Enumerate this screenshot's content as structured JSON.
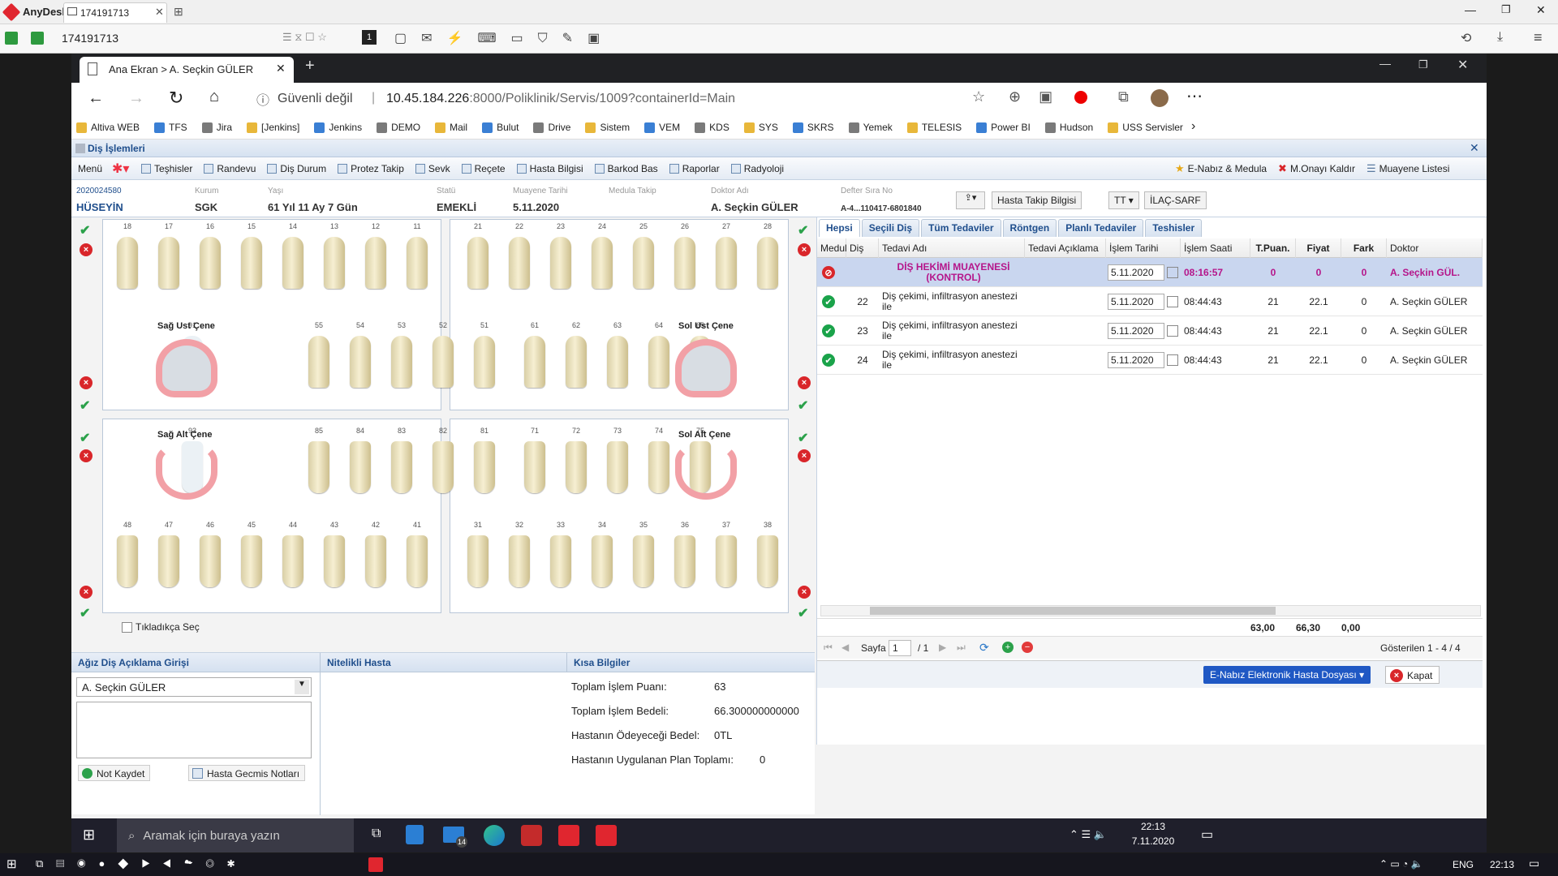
{
  "anydesk": {
    "app_name": "AnyDesk",
    "tab_title": "174191713",
    "address": "174191713",
    "toolbar_page": "1"
  },
  "browser": {
    "tab_title": "Ana Ekran > A. Seçkin GÜLER",
    "security": "Güvenli değil",
    "url_host": "10.45.184.226",
    "url_rest": ":8000/Poliklinik/Servis/1009?containerId=Main",
    "bookmarks": [
      "Altiva WEB",
      "TFS",
      "Jira",
      "[Jenkins]",
      "Jenkins",
      "DEMO",
      "Mail",
      "Bulut",
      "Drive",
      "Sistem",
      "VEM",
      "KDS",
      "SYS",
      "SKRS",
      "Yemek",
      "TELESIS",
      "Power BI",
      "Hudson",
      "USS Servisler"
    ]
  },
  "window": {
    "title": "Diş İşlemleri"
  },
  "toolbar": {
    "menu": "Menü",
    "items": [
      "Teşhisler",
      "Randevu",
      "Diş Durum",
      "Protez Takip",
      "Sevk",
      "Reçete",
      "Hasta Bilgisi",
      "Barkod Bas",
      "Raporlar",
      "Radyoloji"
    ],
    "right": [
      "E-Nabız & Medula",
      "M.Onayı Kaldır",
      "Muayene Listesi"
    ]
  },
  "patient": {
    "id": "2020024580",
    "name": "HÜSEYİN",
    "kurum_label": "Kurum",
    "kurum": "SGK",
    "yas_label": "Yaşı",
    "yas": "61 Yıl 11 Ay 7 Gün",
    "statu_label": "Statü",
    "statu": "EMEKLİ",
    "muayene_label": "Muayene Tarihi",
    "muayene": "5.11.2020",
    "medula_label": "Medula Takip",
    "medula": "",
    "doktor_label": "Doktor Adı",
    "doktor": "A. Seçkin GÜLER",
    "defter_label": "Defter Sıra No",
    "defter": "A-4...110417-6801840",
    "btn_takip": "Hasta Takip Bilgisi",
    "btn_tt": "TT",
    "btn_ilac": "İLAÇ-SARF"
  },
  "chart": {
    "upper_right_nums": [
      "18",
      "17",
      "16",
      "15",
      "14",
      "13",
      "12",
      "11"
    ],
    "upper_left_nums": [
      "21",
      "22",
      "23",
      "24",
      "25",
      "26",
      "27",
      "28"
    ],
    "primary_ur": [
      "91",
      "55",
      "54",
      "53",
      "52",
      "51"
    ],
    "primary_ul": [
      "61",
      "62",
      "63",
      "64",
      "65",
      "92"
    ],
    "primary_lr": [
      "93",
      "85",
      "84",
      "83",
      "82",
      "81"
    ],
    "primary_ll": [
      "71",
      "72",
      "73",
      "74",
      "75",
      "94"
    ],
    "lower_right_nums": [
      "48",
      "47",
      "46",
      "45",
      "44",
      "43",
      "42",
      "41"
    ],
    "lower_left_nums": [
      "31",
      "32",
      "33",
      "34",
      "35",
      "36",
      "37",
      "38"
    ],
    "label_sag_ust": "Sağ Ust Çene",
    "label_sol_ust": "Sol Ust Çene",
    "label_sag_alt": "Sağ Alt Çene",
    "label_sol_alt": "Sol Alt Çene",
    "tikladikca": "Tıkladıkça Seç"
  },
  "tabs": [
    "Hepsi",
    "Seçili Diş",
    "Tüm Tedaviler",
    "Röntgen",
    "Planlı Tedaviler",
    "Teshisler"
  ],
  "grid": {
    "headers": [
      "Medul",
      "Diş",
      "Tedavi Adı",
      "Tedavi Açıklama",
      "İşlem Tarihi",
      "İşlem Saati",
      "T.Puan.",
      "Fiyat",
      "Fark",
      "Doktor"
    ],
    "rows": [
      {
        "dis": "",
        "tedavi": "DİŞ HEKİMİ MUAYENESİ (KONTROL)",
        "tarih": "5.11.2020",
        "saat": "08:16:57",
        "puan": "0",
        "fiyat": "0",
        "fark": "0",
        "doktor": "A. Seçkin GÜL."
      },
      {
        "dis": "22",
        "tedavi": "Diş çekimi, infiltrasyon anestezi ile",
        "tarih": "5.11.2020",
        "saat": "08:44:43",
        "puan": "21",
        "fiyat": "22.1",
        "fark": "0",
        "doktor": "A. Seçkin GÜLER"
      },
      {
        "dis": "23",
        "tedavi": "Diş çekimi, infiltrasyon anestezi ile",
        "tarih": "5.11.2020",
        "saat": "08:44:43",
        "puan": "21",
        "fiyat": "22.1",
        "fark": "0",
        "doktor": "A. Seçkin GÜLER"
      },
      {
        "dis": "24",
        "tedavi": "Diş çekimi, infiltrasyon anestezi ile",
        "tarih": "5.11.2020",
        "saat": "08:44:43",
        "puan": "21",
        "fiyat": "22.1",
        "fark": "0",
        "doktor": "A. Seçkin GÜLER"
      }
    ],
    "total_puan": "63,00",
    "total_fiyat": "66,30",
    "total_fark": "0,00",
    "sayfa_label": "Sayfa",
    "page": "1",
    "of_pages": "/ 1",
    "showing": "Gösterilen 1 - 4 / 4"
  },
  "bottom": {
    "aciklama_title": "Ağız Diş Açıklama Girişi",
    "doktor_select": "A. Seçkin GÜLER",
    "not_kaydet": "Not Kaydet",
    "gecmis": "Hasta Gecmis Notları",
    "nitelikli_title": "Nitelikli Hasta",
    "kisa_title": "Kısa Bilgiler",
    "kisa": [
      {
        "label": "Toplam İşlem Puanı:",
        "value": "63"
      },
      {
        "label": "Toplam İşlem Bedeli:",
        "value": "66.300000000000"
      },
      {
        "label": "Hastanın Ödeyeceği Bedel:",
        "value": "0TL"
      },
      {
        "label": "Hastanın Uygulanan Plan Toplamı:",
        "value": "0"
      }
    ]
  },
  "footer_buttons": {
    "enabiz": "E-Nabız Elektronik Hasta Dosyası",
    "kapat": "Kapat"
  },
  "taskbar": {
    "search": "Aramak için buraya yazın",
    "mail_badge": "14",
    "time": "22:13",
    "date": "7.11.2020",
    "local_time": "22:13",
    "lang": "ENG"
  }
}
